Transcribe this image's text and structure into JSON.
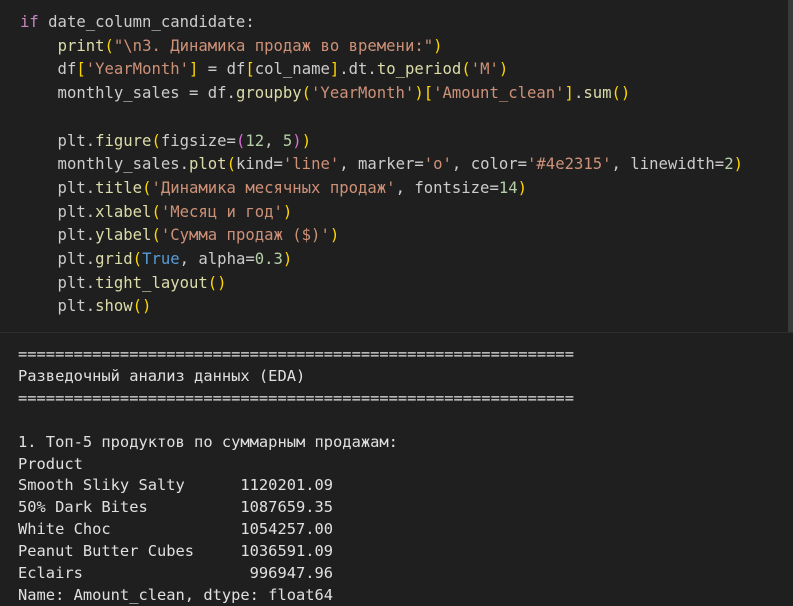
{
  "code_cell": {
    "lines": [
      [
        {
          "t": "if",
          "c": "kw"
        },
        {
          "t": " date_column_candidate:"
        }
      ],
      [
        {
          "t": "    "
        },
        {
          "t": "print",
          "c": "fn"
        },
        {
          "t": "(",
          "c": "b1"
        },
        {
          "t": "\"\\n3. Динамика продаж во времени:\"",
          "c": "str"
        },
        {
          "t": ")",
          "c": "b1"
        }
      ],
      [
        {
          "t": "    df"
        },
        {
          "t": "[",
          "c": "b1"
        },
        {
          "t": "'YearMonth'",
          "c": "str"
        },
        {
          "t": "]",
          "c": "b1"
        },
        {
          "t": " = df"
        },
        {
          "t": "[",
          "c": "b1"
        },
        {
          "t": "col_name"
        },
        {
          "t": "]",
          "c": "b1"
        },
        {
          "t": ".dt."
        },
        {
          "t": "to_period",
          "c": "fn"
        },
        {
          "t": "(",
          "c": "b1"
        },
        {
          "t": "'M'",
          "c": "str"
        },
        {
          "t": ")",
          "c": "b1"
        }
      ],
      [
        {
          "t": "    monthly_sales = df."
        },
        {
          "t": "groupby",
          "c": "fn"
        },
        {
          "t": "(",
          "c": "b1"
        },
        {
          "t": "'YearMonth'",
          "c": "str"
        },
        {
          "t": ")",
          "c": "b1"
        },
        {
          "t": "[",
          "c": "b1"
        },
        {
          "t": "'Amount_clean'",
          "c": "str"
        },
        {
          "t": "]",
          "c": "b1"
        },
        {
          "t": "."
        },
        {
          "t": "sum",
          "c": "fn"
        },
        {
          "t": "()",
          "c": "b1"
        }
      ],
      [],
      [
        {
          "t": "    plt."
        },
        {
          "t": "figure",
          "c": "fn"
        },
        {
          "t": "(",
          "c": "b1"
        },
        {
          "t": "figsize="
        },
        {
          "t": "(",
          "c": "b2"
        },
        {
          "t": "12",
          "c": "num"
        },
        {
          "t": ", "
        },
        {
          "t": "5",
          "c": "num"
        },
        {
          "t": ")",
          "c": "b2"
        },
        {
          "t": ")",
          "c": "b1"
        }
      ],
      [
        {
          "t": "    monthly_sales."
        },
        {
          "t": "plot",
          "c": "fn"
        },
        {
          "t": "(",
          "c": "b1"
        },
        {
          "t": "kind="
        },
        {
          "t": "'line'",
          "c": "str"
        },
        {
          "t": ", marker="
        },
        {
          "t": "'o'",
          "c": "str"
        },
        {
          "t": ", color="
        },
        {
          "t": "'#4e2315'",
          "c": "str"
        },
        {
          "t": ", linewidth="
        },
        {
          "t": "2",
          "c": "num"
        },
        {
          "t": ")",
          "c": "b1"
        }
      ],
      [
        {
          "t": "    plt."
        },
        {
          "t": "title",
          "c": "fn"
        },
        {
          "t": "(",
          "c": "b1"
        },
        {
          "t": "'Динамика месячных продаж'",
          "c": "str"
        },
        {
          "t": ", fontsize="
        },
        {
          "t": "14",
          "c": "num"
        },
        {
          "t": ")",
          "c": "b1"
        }
      ],
      [
        {
          "t": "    plt."
        },
        {
          "t": "xlabel",
          "c": "fn"
        },
        {
          "t": "(",
          "c": "b1"
        },
        {
          "t": "'Месяц и год'",
          "c": "str"
        },
        {
          "t": ")",
          "c": "b1"
        }
      ],
      [
        {
          "t": "    plt."
        },
        {
          "t": "ylabel",
          "c": "fn"
        },
        {
          "t": "(",
          "c": "b1"
        },
        {
          "t": "'Сумма продаж ($)'",
          "c": "str"
        },
        {
          "t": ")",
          "c": "b1"
        }
      ],
      [
        {
          "t": "    plt."
        },
        {
          "t": "grid",
          "c": "fn"
        },
        {
          "t": "(",
          "c": "b1"
        },
        {
          "t": "True",
          "c": "bool"
        },
        {
          "t": ", alpha="
        },
        {
          "t": "0.3",
          "c": "num"
        },
        {
          "t": ")",
          "c": "b1"
        }
      ],
      [
        {
          "t": "    plt."
        },
        {
          "t": "tight_layout",
          "c": "fn"
        },
        {
          "t": "()",
          "c": "b1"
        }
      ],
      [
        {
          "t": "    plt."
        },
        {
          "t": "show",
          "c": "fn"
        },
        {
          "t": "()",
          "c": "b1"
        }
      ]
    ]
  },
  "output": {
    "lines": [
      "============================================================",
      "Разведочный анализ данных (EDA)",
      "============================================================",
      "",
      "1. Топ-5 продуктов по суммарным продажам:",
      "Product",
      "Smooth Sliky Salty      1120201.09",
      "50% Dark Bites          1087659.35",
      "White Choc              1054257.00",
      "Peanut Butter Cubes     1036591.09",
      "Eclairs                  996947.96",
      "Name: Amount_clean, dtype: float64"
    ]
  },
  "theme": {
    "background": "#1f1f1f",
    "keyword": "#c586c0",
    "function": "#dcdcaa",
    "string": "#ce9178",
    "number": "#b5cea8",
    "boolean": "#569cd6",
    "bracket_level1": "#ffd700",
    "bracket_level2": "#da70d6"
  }
}
